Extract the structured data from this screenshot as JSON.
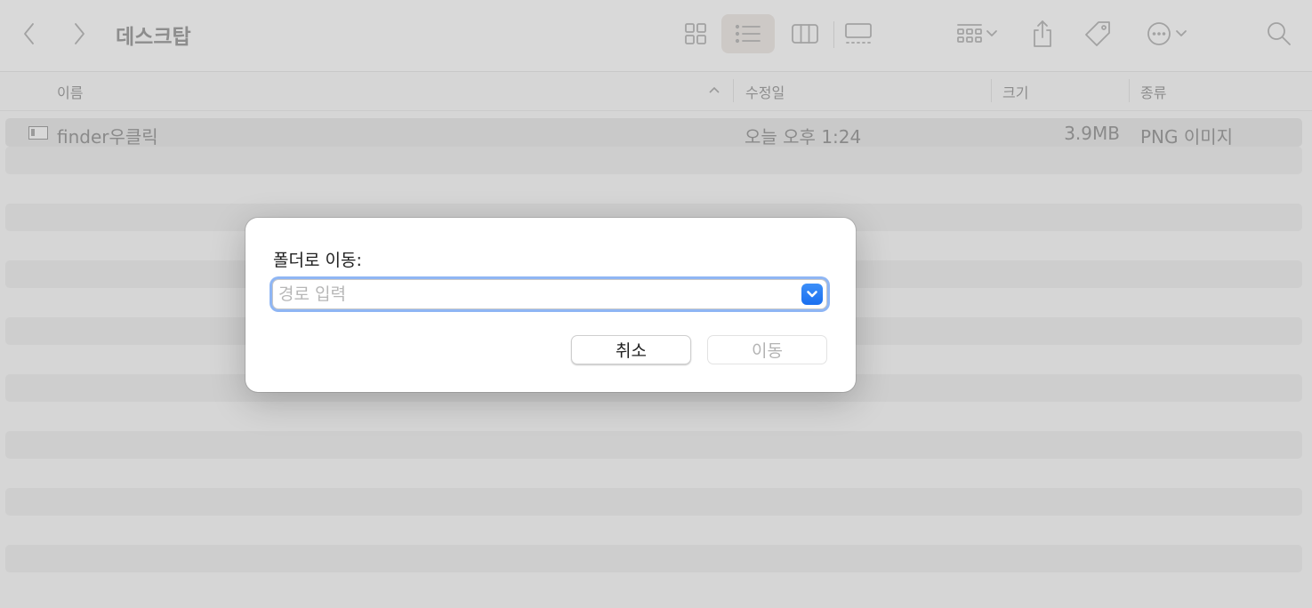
{
  "window": {
    "title": "데스크탑"
  },
  "toolbar": {
    "back_icon": "chevron-left-icon",
    "forward_icon": "chevron-right-icon",
    "views": [
      "icon-view-icon",
      "list-view-icon",
      "column-view-icon",
      "gallery-view-icon"
    ],
    "active_view": "list",
    "group_icon": "group-by-icon",
    "share_icon": "share-icon",
    "tag_icon": "tag-icon",
    "more_icon": "ellipsis-circle-icon",
    "search_icon": "search-icon"
  },
  "columns": {
    "name": "이름",
    "date": "수정일",
    "size": "크기",
    "kind": "종류",
    "sort": "ascending"
  },
  "files": [
    {
      "name": "finder우클릭",
      "date": "오늘 오후 1:24",
      "size": "3.9MB",
      "kind": "PNG 이미지"
    }
  ],
  "dialog": {
    "title": "폴더로 이동:",
    "input_value": "",
    "input_placeholder": "경로 입력",
    "cancel_label": "취소",
    "go_label": "이동"
  },
  "colors": {
    "accent": "#1a6ff0",
    "focus_ring": "#8fb6f4",
    "dimmed_background": "#d6d6d6"
  }
}
